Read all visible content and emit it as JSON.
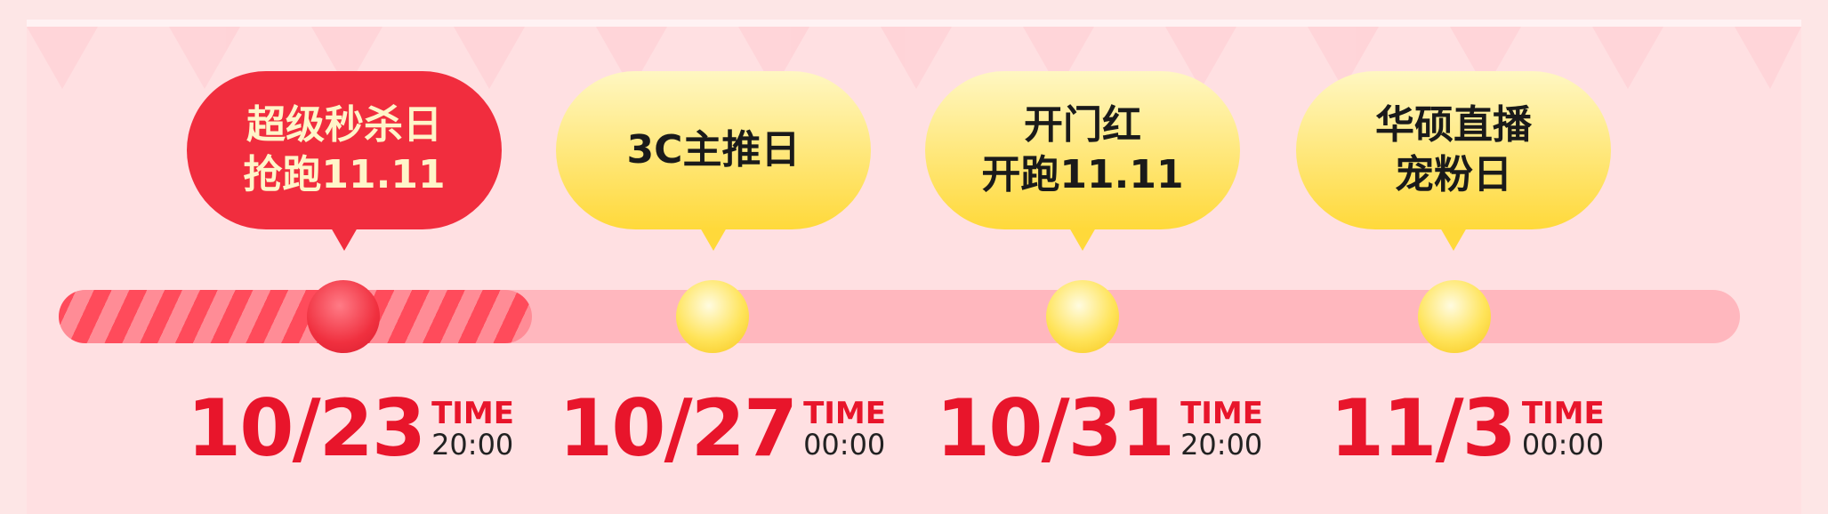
{
  "timeline": {
    "progress_fraction": 0.21,
    "events": [
      {
        "label": "超级秒杀日\n抢跑11.11",
        "date": "10/23",
        "time_label": "TIME",
        "time": "20:00",
        "state": "active"
      },
      {
        "label": "3C主推日",
        "date": "10/27",
        "time_label": "TIME",
        "time": "00:00",
        "state": "upcoming"
      },
      {
        "label": "开门红\n开跑11.11",
        "date": "10/31",
        "time_label": "TIME",
        "time": "20:00",
        "state": "upcoming"
      },
      {
        "label": "华硕直播\n宠粉日",
        "date": "11/3",
        "time_label": "TIME",
        "time": "00:00",
        "state": "upcoming"
      }
    ]
  },
  "colors": {
    "accent": "#e8152b",
    "active_bubble": "#f12d3e",
    "idle_bubble": "#ffd93a",
    "track": "#ffb7be"
  }
}
